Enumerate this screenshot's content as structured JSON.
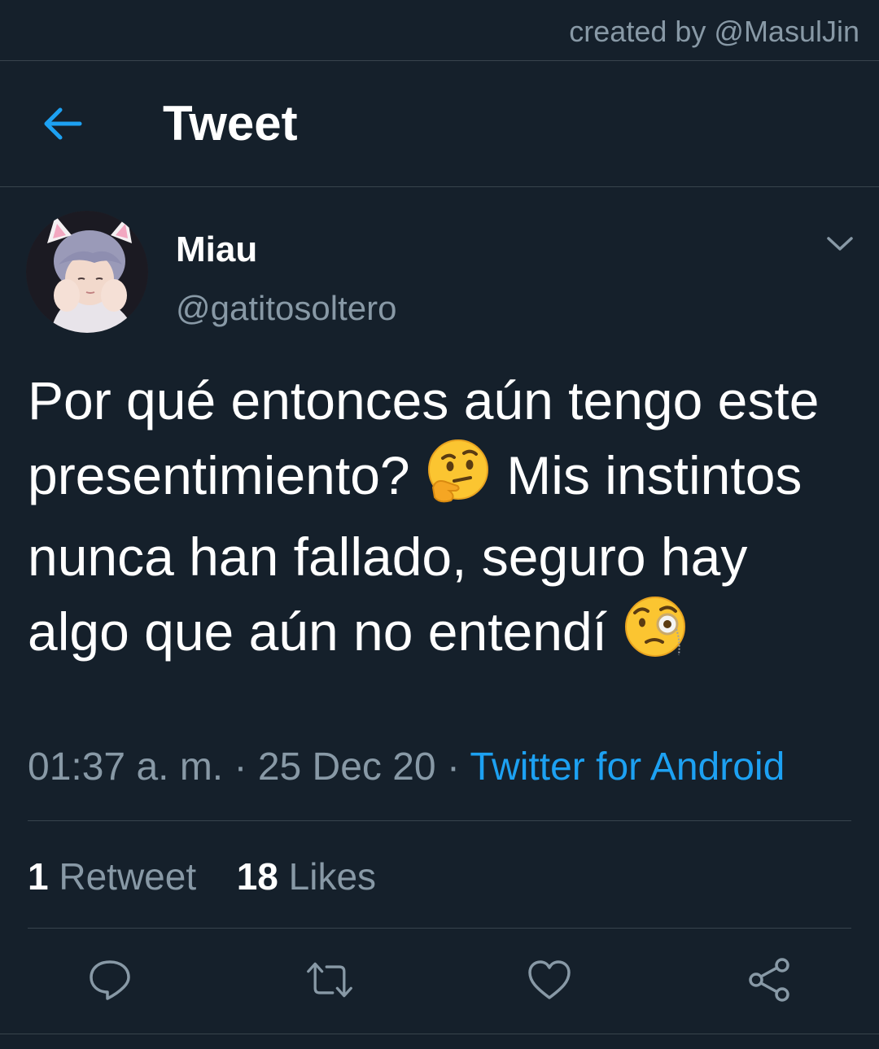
{
  "watermark": "created by @MasulJin",
  "header": {
    "title": "Tweet",
    "back_icon": "arrow-left-icon"
  },
  "tweet": {
    "display_name": "Miau",
    "handle": "@gatitosoltero",
    "text_part1": "Por qué entonces aún tengo este presentimiento?",
    "emoji1": "thinking-face",
    "text_part2": "Mis instintos nunca han fallado, seguro hay algo que aún no entendí",
    "emoji2": "face-with-monocle",
    "time": "01:37 a. m.",
    "date": "25 Dec 20",
    "separator": "·",
    "source": "Twitter for Android"
  },
  "stats": {
    "retweets_count": "1",
    "retweets_label": "Retweet",
    "likes_count": "18",
    "likes_label": "Likes"
  },
  "actions": [
    "reply-icon",
    "retweet-icon",
    "like-icon",
    "share-icon"
  ],
  "colors": {
    "background": "#15202b",
    "divider": "#38444d",
    "accent": "#1da1f2",
    "secondary_text": "#8899a6",
    "primary_text": "#ffffff"
  }
}
